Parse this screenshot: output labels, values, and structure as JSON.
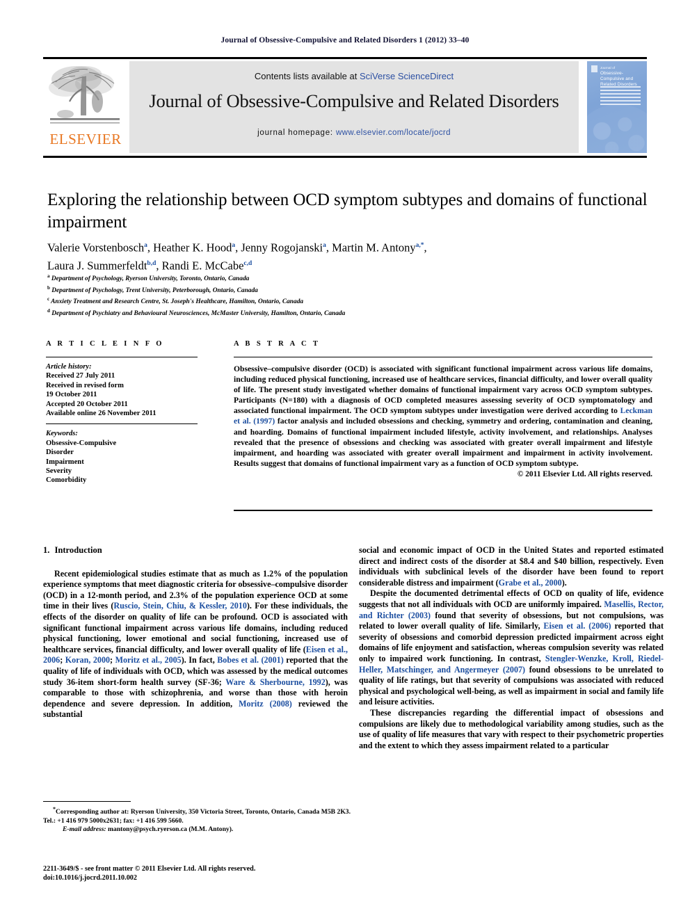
{
  "running_head": "Journal of Obsessive-Compulsive and Related Disorders 1 (2012) 33–40",
  "masthead": {
    "contents_prefix": "Contents lists available at ",
    "contents_link": "SciVerse ScienceDirect",
    "journal_title": "Journal of Obsessive-Compulsive and Related Disorders",
    "homepage_label": "journal homepage:",
    "homepage_url": "www.elsevier.com/locate/jocrd",
    "publisher": "ELSEVIER",
    "accent_orange": "#E87722",
    "link_blue": "#2b4fa2",
    "cover": {
      "line1": "Journal of",
      "line2": "Obsessive-Compulsive and Related Disorders",
      "bg_color": "#86aadb"
    }
  },
  "article": {
    "title": "Exploring the relationship between OCD symptom subtypes and domains of functional impairment",
    "authors_line1_pre": "Valerie Vorstenbosch",
    "authors": "Valerie Vorstenbosch a, Heather K. Hood a, Jenny Rogojanski a, Martin M. Antony a,*, Laura J. Summerfeldt b,d, Randi E. McCabe c,d",
    "affiliations": [
      {
        "mark": "a",
        "text": "Department of Psychology, Ryerson University, Toronto, Ontario, Canada"
      },
      {
        "mark": "b",
        "text": "Department of Psychology, Trent University, Peterborough, Ontario, Canada"
      },
      {
        "mark": "c",
        "text": "Anxiety Treatment and Research Centre, St. Joseph's Healthcare, Hamilton, Ontario, Canada"
      },
      {
        "mark": "d",
        "text": "Department of Psychiatry and Behavioural Neurosciences, McMaster University, Hamilton, Ontario, Canada"
      }
    ]
  },
  "article_info": {
    "heading": "A R T I C L E  I N F O",
    "history_label": "Article history:",
    "history": [
      "Received 27 July 2011",
      "Received in revised form",
      "19 October 2011",
      "Accepted 20 October 2011",
      "Available online 26 November 2011"
    ],
    "keywords_label": "Keywords:",
    "keywords": [
      "Obsessive-Compulsive",
      "Disorder",
      "Impairment",
      "Severity",
      "Comorbidity"
    ]
  },
  "abstract": {
    "heading": "A B S T R A C T",
    "part1": "Obsessive–compulsive disorder (OCD) is associated with significant functional impairment across various life domains, including reduced physical functioning, increased use of healthcare services, financial difficulty, and lower overall quality of life. The present study investigated whether domains of functional impairment vary across OCD symptom subtypes. Participants (N=180) with a diagnosis of OCD completed measures assessing severity of OCD symptomatology and associated functional impairment. The OCD symptom subtypes under investigation were derived according to ",
    "ref1": "Leckman et al. (1997)",
    "part2": " factor analysis and included obsessions and checking, symmetry and ordering, contamination and cleaning, and hoarding. Domains of functional impairment included lifestyle, activity involvement, and relationships. Analyses revealed that the presence of obsessions and checking was associated with greater overall impairment and lifestyle impairment, and hoarding was associated with greater overall impairment and impairment in activity involvement. Results suggest that domains of functional impairment vary as a function of OCD symptom subtype.",
    "copyright": "© 2011 Elsevier Ltd. All rights reserved."
  },
  "body": {
    "intro_number": "1.",
    "intro_title": "Introduction",
    "left_paragraphs": [
      {
        "segments": [
          {
            "t": "Recent epidemiological studies estimate that as much as 1.2% of the population experience symptoms that meet diagnostic criteria for obsessive–compulsive disorder (OCD) in a 12-month period, and 2.3% of the population experience OCD at some time in their lives (",
            "ref": false
          },
          {
            "t": "Ruscio, Stein, Chiu, & Kessler, 2010",
            "ref": true
          },
          {
            "t": "). For these individuals, the effects of the disorder on quality of life can be profound. OCD is associated with significant functional impairment across various life domains, including reduced physical functioning, lower emotional and social functioning, increased use of healthcare services, financial difficulty, and lower overall quality of life (",
            "ref": false
          },
          {
            "t": "Eisen et al., 2006",
            "ref": true
          },
          {
            "t": "; ",
            "ref": false
          },
          {
            "t": "Koran, 2000",
            "ref": true
          },
          {
            "t": "; ",
            "ref": false
          },
          {
            "t": "Moritz et al., 2005",
            "ref": true
          },
          {
            "t": "). In fact, ",
            "ref": false
          },
          {
            "t": "Bobes et al. (2001)",
            "ref": true
          },
          {
            "t": " reported that the quality of life of individuals with OCD, which was assessed by the medical outcomes study 36-item short-form health survey (SF-36; ",
            "ref": false
          },
          {
            "t": "Ware & Sherbourne, 1992",
            "ref": true
          },
          {
            "t": "), was comparable to those with schizophrenia, and worse than those with heroin dependence and severe depression. In addition, ",
            "ref": false
          },
          {
            "t": "Moritz (2008)",
            "ref": true
          },
          {
            "t": " reviewed the substantial",
            "ref": false
          }
        ]
      }
    ],
    "right_paragraphs": [
      {
        "indent": false,
        "segments": [
          {
            "t": "social and economic impact of OCD in the United States and reported estimated direct and indirect costs of the disorder at $8.4 and $40 billion, respectively. Even individuals with subclinical levels of the disorder have been found to report considerable distress and impairment (",
            "ref": false
          },
          {
            "t": "Grabe et al., 2000",
            "ref": true
          },
          {
            "t": ").",
            "ref": false
          }
        ]
      },
      {
        "indent": true,
        "segments": [
          {
            "t": "Despite the documented detrimental effects of OCD on quality of life, evidence suggests that not all individuals with OCD are uniformly impaired. ",
            "ref": false
          },
          {
            "t": "Masellis, Rector, and Richter (2003)",
            "ref": true
          },
          {
            "t": " found that severity of obsessions, but not compulsions, was related to lower overall quality of life. Similarly, ",
            "ref": false
          },
          {
            "t": "Eisen et al. (2006)",
            "ref": true
          },
          {
            "t": " reported that severity of obsessions and comorbid depression predicted impairment across eight domains of life enjoyment and satisfaction, whereas compulsion severity was related only to impaired work functioning. In contrast, ",
            "ref": false
          },
          {
            "t": "Stengler-Wenzke, Kroll, Riedel-Heller, Matschinger, and Angermeyer (2007)",
            "ref": true
          },
          {
            "t": " found obsessions to be unrelated to quality of life ratings, but that severity of compulsions was associated with reduced physical and psychological well-being, as well as impairment in social and family life and leisure activities.",
            "ref": false
          }
        ]
      },
      {
        "indent": true,
        "segments": [
          {
            "t": "These discrepancies regarding the differential impact of obsessions and compulsions are likely due to methodological variability among studies, such as the use of quality of life measures that vary with respect to their psychometric properties and the extent to which they assess impairment related to a particular",
            "ref": false
          }
        ]
      }
    ]
  },
  "footer": {
    "corresponding_marker": "*",
    "corresponding": "Corresponding author at: Ryerson University, 350 Victoria Street, Toronto, Ontario, Canada M5B 2K3. Tel.: +1 416 979 5000x2631; fax: +1 416 599 5660.",
    "email_label": "E-mail address:",
    "email": "mantony@psych.ryerson.ca (M.M. Antony).",
    "imprint": "2211-3649/$ - see front matter © 2011 Elsevier Ltd. All rights reserved.",
    "doi": "doi:10.1016/j.jocrd.2011.10.002"
  }
}
